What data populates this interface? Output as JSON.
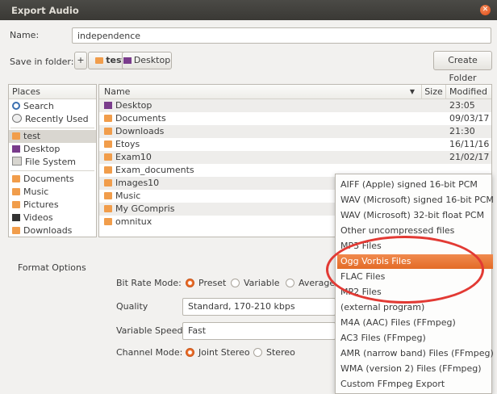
{
  "window": {
    "title": "Export Audio",
    "close_icon": "close-icon"
  },
  "name_row": {
    "label": "Name:",
    "value": "independence"
  },
  "save_row": {
    "label": "Save in folder:",
    "toggle": "+",
    "crumbs": [
      "test",
      "Desktop"
    ],
    "create_folder": "Create Folder"
  },
  "places": {
    "header": "Places",
    "items": [
      {
        "label": "Search",
        "icon": "search-icon"
      },
      {
        "label": "Recently Used",
        "icon": "clock-icon"
      },
      {
        "label": "test",
        "icon": "home-folder-icon"
      },
      {
        "label": "Desktop",
        "icon": "desktop-icon"
      },
      {
        "label": "File System",
        "icon": "drive-icon"
      },
      {
        "label": "Documents",
        "icon": "folder-icon"
      },
      {
        "label": "Music",
        "icon": "music-folder-icon"
      },
      {
        "label": "Pictures",
        "icon": "pictures-folder-icon"
      },
      {
        "label": "Videos",
        "icon": "videos-folder-icon"
      },
      {
        "label": "Downloads",
        "icon": "downloads-folder-icon"
      }
    ]
  },
  "files": {
    "col_name": "Name",
    "col_size": "Size",
    "col_modified": "Modified",
    "sort_icon": "sort-down-icon",
    "rows": [
      {
        "name": "Desktop",
        "modified": "23:05"
      },
      {
        "name": "Documents",
        "modified": "09/03/17"
      },
      {
        "name": "Downloads",
        "modified": "21:30"
      },
      {
        "name": "Etoys",
        "modified": "16/11/16"
      },
      {
        "name": "Exam10",
        "modified": "21/02/17"
      },
      {
        "name": "Exam_documents",
        "modified": ""
      },
      {
        "name": "Images10",
        "modified": ""
      },
      {
        "name": "Music",
        "modified": ""
      },
      {
        "name": "My GCompris",
        "modified": ""
      },
      {
        "name": "omnitux",
        "modified": ""
      }
    ]
  },
  "format_options": {
    "header": "Format Options",
    "bit_rate_label": "Bit Rate Mode:",
    "bit_rate_options": [
      "Preset",
      "Variable",
      "Average"
    ],
    "bit_rate_selected": "Preset",
    "quality_label": "Quality",
    "quality_value": "Standard, 170-210 kbps",
    "variable_speed_label": "Variable Speed:",
    "variable_speed_value": "Fast",
    "channel_mode_label": "Channel Mode:",
    "channel_mode_options": [
      "Joint Stereo",
      "Stereo"
    ],
    "channel_mode_selected": "Joint Stereo"
  },
  "file_type_menu": {
    "items": [
      "AIFF (Apple) signed 16-bit PCM",
      "WAV (Microsoft) signed 16-bit PCM",
      "WAV (Microsoft) 32-bit float PCM",
      "Other uncompressed files",
      "MP3 Files",
      "Ogg Vorbis Files",
      "FLAC Files",
      "MP2 Files",
      "(external program)",
      "M4A (AAC) Files (FFmpeg)",
      "AC3 Files (FFmpeg)",
      "AMR (narrow band) Files (FFmpeg)",
      "WMA (version 2) Files (FFmpeg)",
      "Custom FFmpeg Export"
    ],
    "highlighted": "Ogg Vorbis Files",
    "highlight_color": "#e7732f",
    "annotation_color": "#e23a34"
  }
}
